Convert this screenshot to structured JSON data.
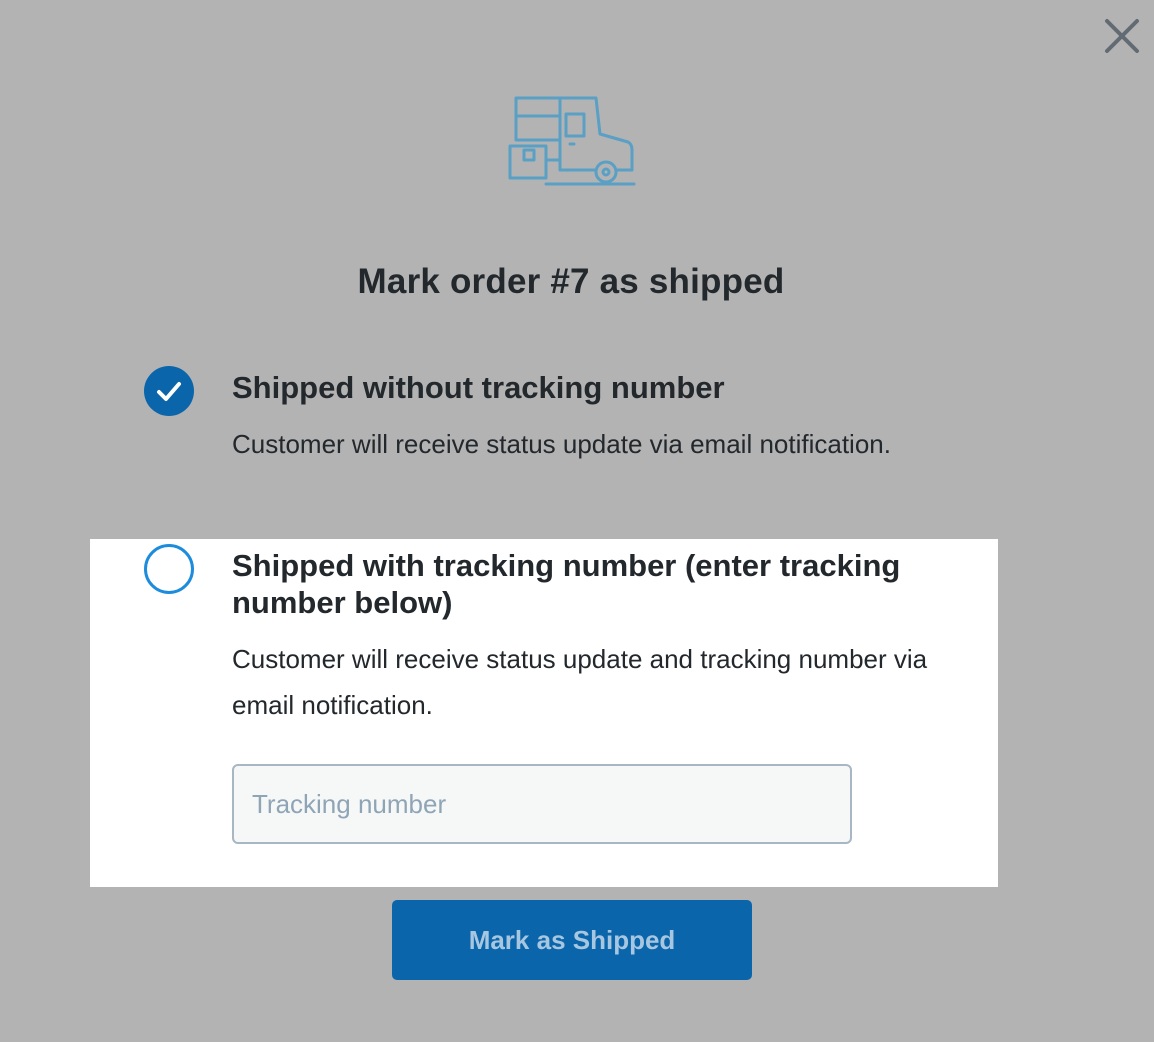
{
  "modal": {
    "title": "Mark order #7 as shipped",
    "close_icon": "close-icon",
    "illustration_icon": "delivery-truck-icon",
    "options": [
      {
        "title": "Shipped without tracking number",
        "description": "Customer will receive status update via email notification.",
        "selected": true
      },
      {
        "title": "Shipped with tracking number (enter tracking number below)",
        "description": "Customer will receive status update and tracking number via email notification.",
        "selected": false
      }
    ],
    "tracking_input": {
      "placeholder": "Tracking number",
      "value": ""
    },
    "submit_label": "Mark as Shipped"
  },
  "colors": {
    "overlay": "#b3b3b3",
    "accent": "#0b65ab",
    "radio_outline": "#1e8cdc",
    "truck_stroke": "#5a9fc4",
    "text": "#23282d"
  }
}
